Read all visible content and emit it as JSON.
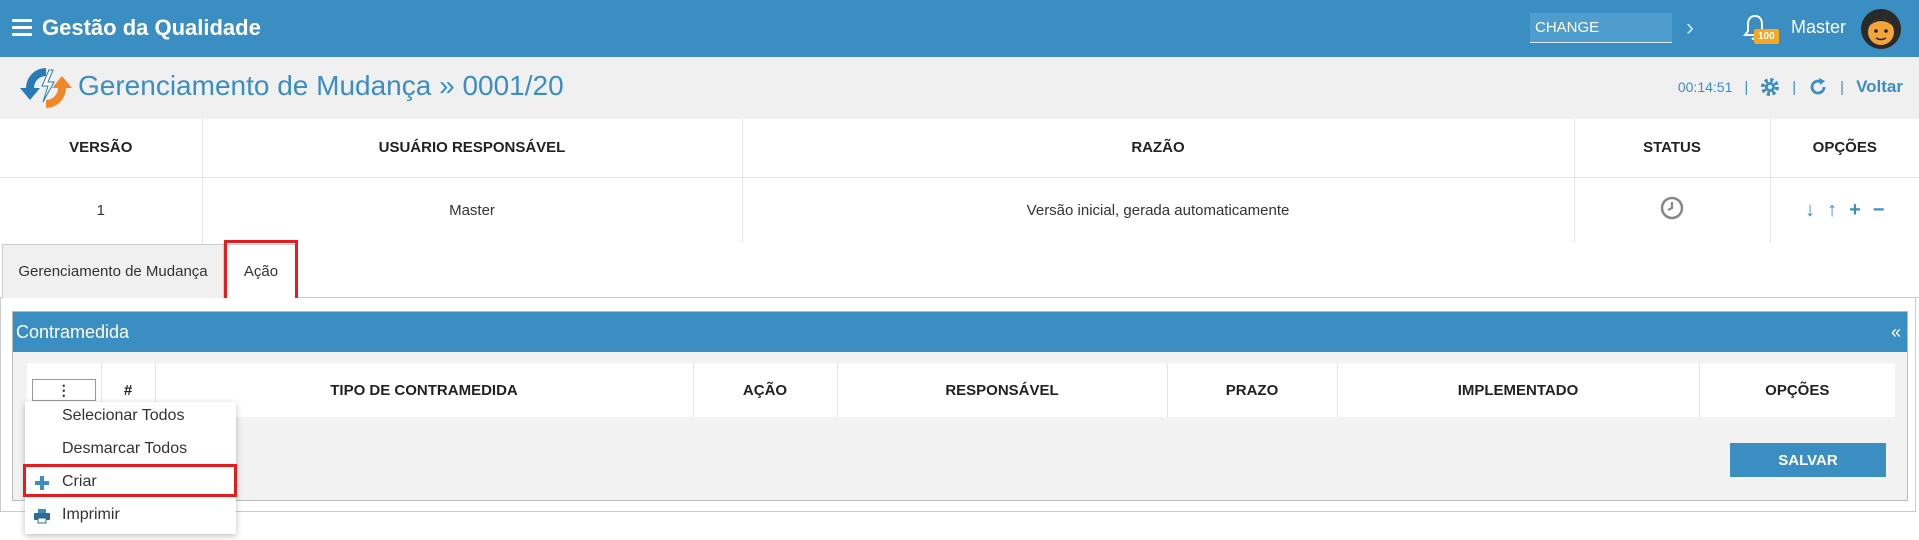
{
  "topbar": {
    "app_title": "Gestão da Qualidade",
    "module_value": "CHANGE",
    "notification_count": "100",
    "user_name": "Master"
  },
  "header": {
    "title": "Gerenciamento de Mudança » 0001/20",
    "timer": "00:14:51",
    "back_label": "Voltar"
  },
  "versions": {
    "columns": [
      "VERSÃO",
      "USUÁRIO RESPONSÁVEL",
      "RAZÃO",
      "STATUS",
      "OPÇÕES"
    ],
    "rows": [
      {
        "version": "1",
        "user": "Master",
        "reason": "Versão inicial, gerada automaticamente",
        "status": "clock-icon"
      }
    ]
  },
  "tabs": [
    {
      "label": "Gerenciamento de Mudança"
    },
    {
      "label": "Ação"
    }
  ],
  "panel": {
    "title": "Contramedida",
    "collapse_label": "«",
    "columns": [
      "#",
      "TIPO DE CONTRAMEDIDA",
      "AÇÃO",
      "RESPONSÁVEL",
      "PRAZO",
      "IMPLEMENTADO",
      "OPÇÕES"
    ],
    "kebab_label": "⋮",
    "save_label": "SALVAR"
  },
  "dropdown": {
    "items": [
      {
        "label": "Selecionar Todos",
        "icon": ""
      },
      {
        "label": "Desmarcar Todos",
        "icon": ""
      },
      {
        "label": "Criar",
        "icon": "plus-icon"
      },
      {
        "label": "Imprimir",
        "icon": "printer-icon"
      }
    ]
  },
  "colors": {
    "primary": "#3b8ec2",
    "highlight": "#e81c1c",
    "badge": "#f5a623"
  }
}
